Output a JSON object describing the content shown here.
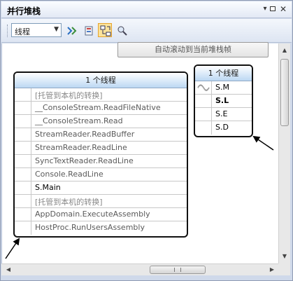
{
  "window": {
    "title": "并行堆栈"
  },
  "toolbar": {
    "view_combo_value": "线程",
    "buttons": [
      "toggle-method-view-icon",
      "toggle-zoom-icon",
      "auto-scroll-icon",
      "zoom-icon"
    ]
  },
  "auto_scroll_button": {
    "label": "自动滚动到当前堆栈帧"
  },
  "stacks": [
    {
      "header": "1 个线程",
      "frames": [
        "[托管到本机的转换]",
        "__ConsoleStream.ReadFileNative",
        "__ConsoleStream.Read",
        "StreamReader.ReadBuffer",
        "StreamReader.ReadLine",
        "SyncTextReader.ReadLine",
        "Console.ReadLine",
        "S.Main",
        "[托管到本机的转换]",
        "AppDomain.ExecuteAssembly",
        "HostProc.RunUsersAssembly"
      ]
    },
    {
      "header": "1 个线程",
      "frames": [
        "S.M",
        "S.L",
        "S.E",
        "S.D"
      ]
    }
  ],
  "colors": {
    "header_gradient_bottom": "#bcd8f3",
    "active_toolbar_button": "#fbe39a",
    "box_border": "#111111"
  }
}
